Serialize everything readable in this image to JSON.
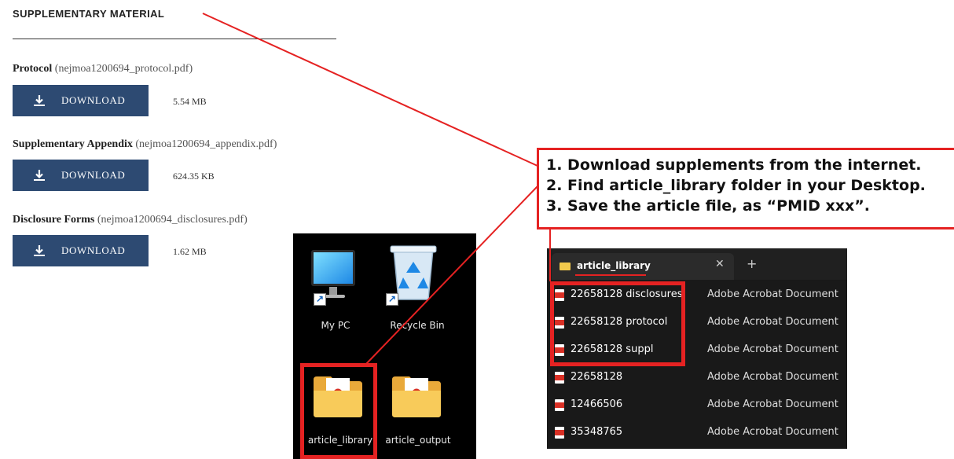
{
  "supplementary": {
    "title": "SUPPLEMENTARY MATERIAL",
    "files": [
      {
        "label": "Protocol",
        "filename": "(nejmoa1200694_protocol.pdf)",
        "button": "DOWNLOAD",
        "size": "5.54 MB"
      },
      {
        "label": "Supplementary Appendix",
        "filename": "(nejmoa1200694_appendix.pdf)",
        "button": "DOWNLOAD",
        "size": "624.35 KB"
      },
      {
        "label": "Disclosure Forms",
        "filename": "(nejmoa1200694_disclosures.pdf)",
        "button": "DOWNLOAD",
        "size": "1.62 MB"
      }
    ]
  },
  "desktop": {
    "icons": [
      {
        "label": "My PC",
        "icon": "monitor-icon"
      },
      {
        "label": "Recycle Bin",
        "icon": "recycle-bin-icon"
      },
      {
        "label": "article_library",
        "icon": "pdf-folder-icon"
      },
      {
        "label": "article_output",
        "icon": "pdf-folder-icon"
      }
    ]
  },
  "callout": {
    "lines": [
      "1. Download supplements from the internet.",
      "2. Find article_library folder in your Desktop.",
      "3. Save the article file, as “PMID xxx”."
    ]
  },
  "explorer": {
    "tab_label": "article_library",
    "close_glyph": "✕",
    "new_tab_glyph": "+",
    "rows": [
      {
        "name": "22658128 disclosures",
        "type": "Adobe Acrobat Document"
      },
      {
        "name": "22658128 protocol",
        "type": "Adobe Acrobat Document"
      },
      {
        "name": "22658128 suppl",
        "type": "Adobe Acrobat Document"
      },
      {
        "name": "22658128",
        "type": "Adobe Acrobat Document"
      },
      {
        "name": "12466506",
        "type": "Adobe Acrobat Document"
      },
      {
        "name": "35348765",
        "type": "Adobe Acrobat Document"
      }
    ]
  },
  "colors": {
    "annotation_red": "#e52222",
    "download_button": "#2d4a72",
    "explorer_bg": "#191919"
  }
}
